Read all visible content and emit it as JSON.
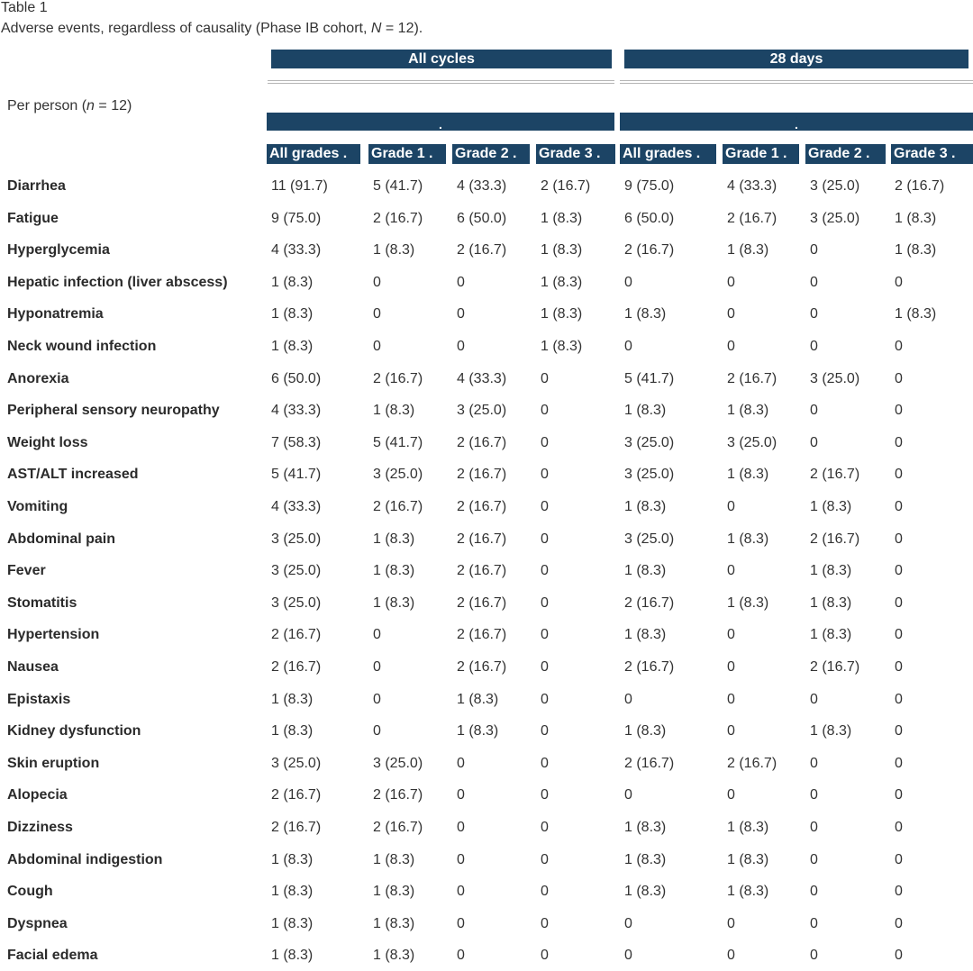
{
  "caption": {
    "label": "Table 1",
    "text_before": "Adverse events, regardless of causality (Phase IB cohort, ",
    "text_italic": "N",
    "text_after": " = 12)."
  },
  "header": {
    "stub_before": "Per person (",
    "stub_italic": "n",
    "stub_after": " = 12)",
    "groups": [
      {
        "label": "All cycles",
        "sub_label": "."
      },
      {
        "label": "28 days",
        "sub_label": "."
      }
    ],
    "columns": [
      "All grades .",
      "Grade 1 .",
      "Grade 2 .",
      "Grade 3 .",
      "All grades .",
      "Grade 1 .",
      "Grade 2 .",
      "Grade 3 ."
    ]
  },
  "rows": [
    {
      "label": "Diarrhea",
      "cells": [
        "11 (91.7)",
        "5 (41.7)",
        "4 (33.3)",
        "2 (16.7)",
        "9 (75.0)",
        "4 (33.3)",
        "3 (25.0)",
        "2 (16.7)"
      ]
    },
    {
      "label": "Fatigue",
      "cells": [
        "9 (75.0)",
        "2 (16.7)",
        "6 (50.0)",
        "1 (8.3)",
        "6 (50.0)",
        "2 (16.7)",
        "3 (25.0)",
        "1 (8.3)"
      ]
    },
    {
      "label": "Hyperglycemia",
      "cells": [
        "4 (33.3)",
        "1 (8.3)",
        "2 (16.7)",
        "1 (8.3)",
        "2 (16.7)",
        "1 (8.3)",
        "0",
        "1 (8.3)"
      ]
    },
    {
      "label": "Hepatic infection (liver abscess)",
      "cells": [
        "1 (8.3)",
        "0",
        "0",
        "1 (8.3)",
        "0",
        "0",
        "0",
        "0"
      ]
    },
    {
      "label": "Hyponatremia",
      "cells": [
        "1 (8.3)",
        "0",
        "0",
        "1 (8.3)",
        "1 (8.3)",
        "0",
        "0",
        "1 (8.3)"
      ]
    },
    {
      "label": "Neck wound infection",
      "cells": [
        "1 (8.3)",
        "0",
        "0",
        "1 (8.3)",
        "0",
        "0",
        "0",
        "0"
      ]
    },
    {
      "label": "Anorexia",
      "cells": [
        "6 (50.0)",
        "2 (16.7)",
        "4 (33.3)",
        "0",
        "5 (41.7)",
        "2 (16.7)",
        "3 (25.0)",
        "0"
      ]
    },
    {
      "label": "Peripheral sensory neuropathy",
      "cells": [
        "4 (33.3)",
        "1 (8.3)",
        "3 (25.0)",
        "0",
        "1 (8.3)",
        "1 (8.3)",
        "0",
        "0"
      ]
    },
    {
      "label": "Weight loss",
      "cells": [
        "7 (58.3)",
        "5 (41.7)",
        "2 (16.7)",
        "0",
        "3 (25.0)",
        "3 (25.0)",
        "0",
        "0"
      ]
    },
    {
      "label": "AST/ALT increased",
      "cells": [
        "5 (41.7)",
        "3 (25.0)",
        "2 (16.7)",
        "0",
        "3 (25.0)",
        "1 (8.3)",
        "2 (16.7)",
        "0"
      ]
    },
    {
      "label": "Vomiting",
      "cells": [
        "4 (33.3)",
        "2 (16.7)",
        "2 (16.7)",
        "0",
        "1 (8.3)",
        "0",
        "1 (8.3)",
        "0"
      ]
    },
    {
      "label": "Abdominal pain",
      "cells": [
        "3 (25.0)",
        "1 (8.3)",
        "2 (16.7)",
        "0",
        "3 (25.0)",
        "1 (8.3)",
        "2 (16.7)",
        "0"
      ]
    },
    {
      "label": "Fever",
      "cells": [
        "3 (25.0)",
        "1 (8.3)",
        "2 (16.7)",
        "0",
        "1 (8.3)",
        "0",
        "1 (8.3)",
        "0"
      ]
    },
    {
      "label": "Stomatitis",
      "cells": [
        "3 (25.0)",
        "1 (8.3)",
        "2 (16.7)",
        "0",
        "2 (16.7)",
        "1 (8.3)",
        "1 (8.3)",
        "0"
      ]
    },
    {
      "label": "Hypertension",
      "cells": [
        "2 (16.7)",
        "0",
        "2 (16.7)",
        "0",
        "1 (8.3)",
        "0",
        "1 (8.3)",
        "0"
      ]
    },
    {
      "label": "Nausea",
      "cells": [
        "2 (16.7)",
        "0",
        "2 (16.7)",
        "0",
        "2 (16.7)",
        "0",
        "2 (16.7)",
        "0"
      ]
    },
    {
      "label": "Epistaxis",
      "cells": [
        "1 (8.3)",
        "0",
        "1 (8.3)",
        "0",
        "0",
        "0",
        "0",
        "0"
      ]
    },
    {
      "label": "Kidney dysfunction",
      "cells": [
        "1 (8.3)",
        "0",
        "1 (8.3)",
        "0",
        "1 (8.3)",
        "0",
        "1 (8.3)",
        "0"
      ]
    },
    {
      "label": "Skin eruption",
      "cells": [
        "3 (25.0)",
        "3 (25.0)",
        "0",
        "0",
        "2 (16.7)",
        "2 (16.7)",
        "0",
        "0"
      ]
    },
    {
      "label": "Alopecia",
      "cells": [
        "2 (16.7)",
        "2 (16.7)",
        "0",
        "0",
        "0",
        "0",
        "0",
        "0"
      ]
    },
    {
      "label": "Dizziness",
      "cells": [
        "2 (16.7)",
        "2 (16.7)",
        "0",
        "0",
        "1 (8.3)",
        "1 (8.3)",
        "0",
        "0"
      ]
    },
    {
      "label": "Abdominal indigestion",
      "cells": [
        "1 (8.3)",
        "1 (8.3)",
        "0",
        "0",
        "1 (8.3)",
        "1 (8.3)",
        "0",
        "0"
      ]
    },
    {
      "label": "Cough",
      "cells": [
        "1 (8.3)",
        "1 (8.3)",
        "0",
        "0",
        "1 (8.3)",
        "1 (8.3)",
        "0",
        "0"
      ]
    },
    {
      "label": "Dyspnea",
      "cells": [
        "1 (8.3)",
        "1 (8.3)",
        "0",
        "0",
        "0",
        "0",
        "0",
        "0"
      ]
    },
    {
      "label": "Facial edema",
      "cells": [
        "1 (8.3)",
        "1 (8.3)",
        "0",
        "0",
        "0",
        "0",
        "0",
        "0"
      ]
    }
  ],
  "colors": {
    "header_bg": "#1c4465",
    "header_text": "#ffffff",
    "rule": "#b5b5b5"
  }
}
